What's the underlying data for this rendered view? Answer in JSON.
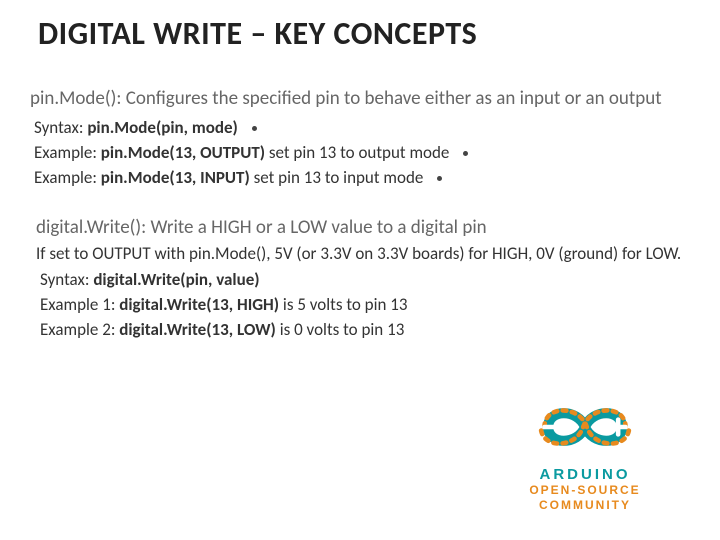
{
  "title": "DIGITAL WRITE – KEY CONCEPTS",
  "pinmode": {
    "desc": "pin.Mode(): Configures the specified pin to behave either as an input or an output",
    "syntax_label": "Syntax: ",
    "syntax_value": "pin.Mode(pin, mode)",
    "ex1_label": "Example: ",
    "ex1_bold": "pin.Mode(13, OUTPUT)",
    "ex1_rest": " set pin 13 to output mode",
    "ex2_label": "Example: ",
    "ex2_bold": "pin.Mode(13, INPUT)",
    "ex2_rest": " set pin 13 to input mode"
  },
  "digitalwrite": {
    "desc": "digital.Write(): Write a HIGH or a LOW value to a digital pin",
    "sub": "If set to OUTPUT with pin.Mode(), 5V (or 3.3V on 3.3V boards) for HIGH, 0V (ground) for LOW.",
    "syntax_label": "Syntax: ",
    "syntax_value": "digital.Write(pin, value)",
    "ex1_label": "Example 1: ",
    "ex1_bold": "digital.Write(13, HIGH)",
    "ex1_rest": " is 5 volts  to pin 13",
    "ex2_label": "Example 2: ",
    "ex2_bold": "digital.Write(13, LOW)",
    "ex2_rest": " is 0 volts to pin 13"
  },
  "logo": {
    "line1": "ARDUINO",
    "line2a": "OPEN-SOURCE",
    "line2b": "COMMUNITY"
  },
  "colors": {
    "teal": "#0a9aa0",
    "orange": "#e78a1e"
  }
}
